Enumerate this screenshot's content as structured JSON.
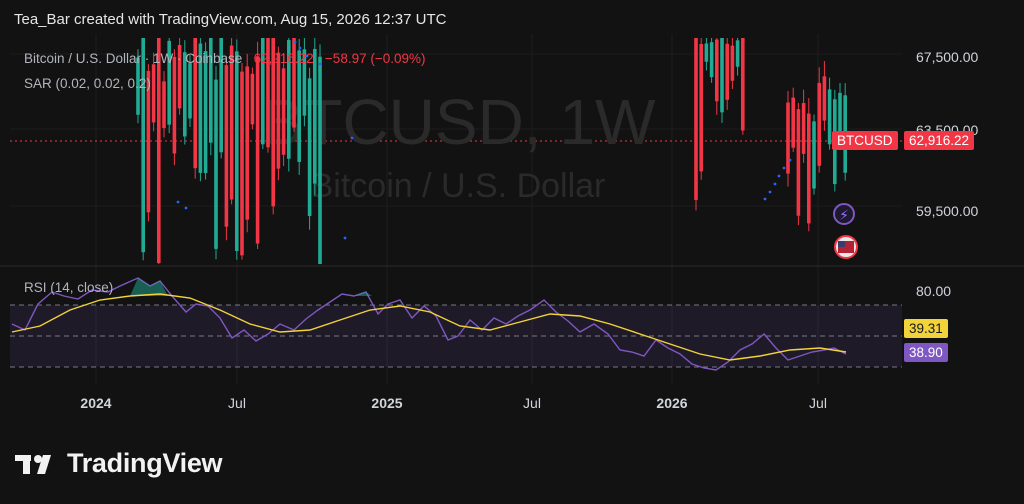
{
  "header": {
    "text": "Tea_Bar created with TradingView.com, Aug 15, 2026 12:37 UTC"
  },
  "legend": {
    "symbol": "Bitcoin / U.S. Dollar · 1W · Coinbase",
    "price": "62,916.22",
    "change": "−58.97 (−0.09%)",
    "sar": "SAR (0.02, 0.02, 0.2)"
  },
  "watermark": {
    "ticker": "BTCUSD, 1W",
    "name": "Bitcoin / U.S. Dollar"
  },
  "price_axis": {
    "labels": [
      "67,500.00",
      "63,500.00",
      "59,500.00"
    ]
  },
  "price_tags": {
    "symbol": "BTCUSD",
    "price": "62,916.22"
  },
  "rsi": {
    "label": "RSI (14, close)",
    "axis_label": "80.00",
    "ma_value": "39.31",
    "rsi_value": "38.90"
  },
  "time_axis": {
    "labels": [
      "2024",
      "Jul",
      "2025",
      "Jul",
      "2026",
      "Jul"
    ]
  },
  "brand": {
    "name": "TradingView"
  },
  "colors": {
    "up": "#22ab94",
    "down": "#f23645",
    "rsi": "#7e57c2",
    "rsi_ma": "#f2d33a",
    "sar": "#2962ff"
  },
  "chart_data": [
    {
      "type": "candlestick",
      "title": "Bitcoin / U.S. Dollar",
      "interval": "1W",
      "exchange": "Coinbase",
      "last_price": 62916.22,
      "change": -58.97,
      "change_pct": -0.09,
      "y_ticks": [
        67500,
        63500,
        59500
      ],
      "x_ticks": [
        "2024",
        "Jul",
        "2025",
        "Jul",
        "2026",
        "Jul"
      ],
      "overlay": "SAR (0.02, 0.02, 0.2)"
    },
    {
      "type": "line",
      "title": "RSI (14, close)",
      "series": [
        {
          "name": "RSI",
          "last": 38.9
        },
        {
          "name": "RSI MA",
          "last": 39.31
        }
      ],
      "y_ticks": [
        80
      ],
      "bands": [
        70,
        50,
        30
      ]
    }
  ]
}
